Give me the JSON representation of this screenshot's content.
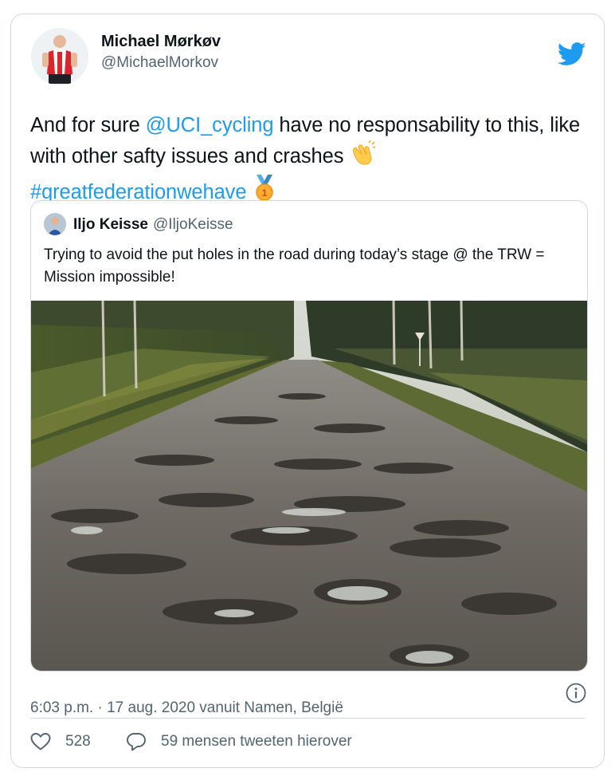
{
  "tweet": {
    "author_name": "Michael Mørkøv",
    "author_handle": "@MichaelMorkov",
    "text_part1": "And for sure ",
    "mention": "@UCI_cycling",
    "text_part2": " have no responsability to this, like with other safty issues and crashes ",
    "hashtag": "#greatfederationwehave",
    "emoji_1": "clapping-hands",
    "emoji_2": "gold-medal"
  },
  "quoted": {
    "author_name": "Iljo Keisse",
    "author_handle": "@IljoKeisse",
    "text": "Trying to avoid the put holes in the road during today’s stage @ the TRW = Mission impossible!",
    "image": "pothole-covered forest road"
  },
  "meta": {
    "timestamp": "6:03 p.m. · 17 aug. 2020 vanuit Namen, België"
  },
  "actions": {
    "likes": "528",
    "retweets_text": "59 mensen tweeten hierover"
  },
  "colors": {
    "link": "#1d9bf0",
    "text": "#0f1419",
    "secondary": "#536471",
    "border": "#cfd9de"
  },
  "icons": [
    "twitter-bird-icon",
    "info-icon",
    "heart-icon",
    "comment-icon"
  ]
}
